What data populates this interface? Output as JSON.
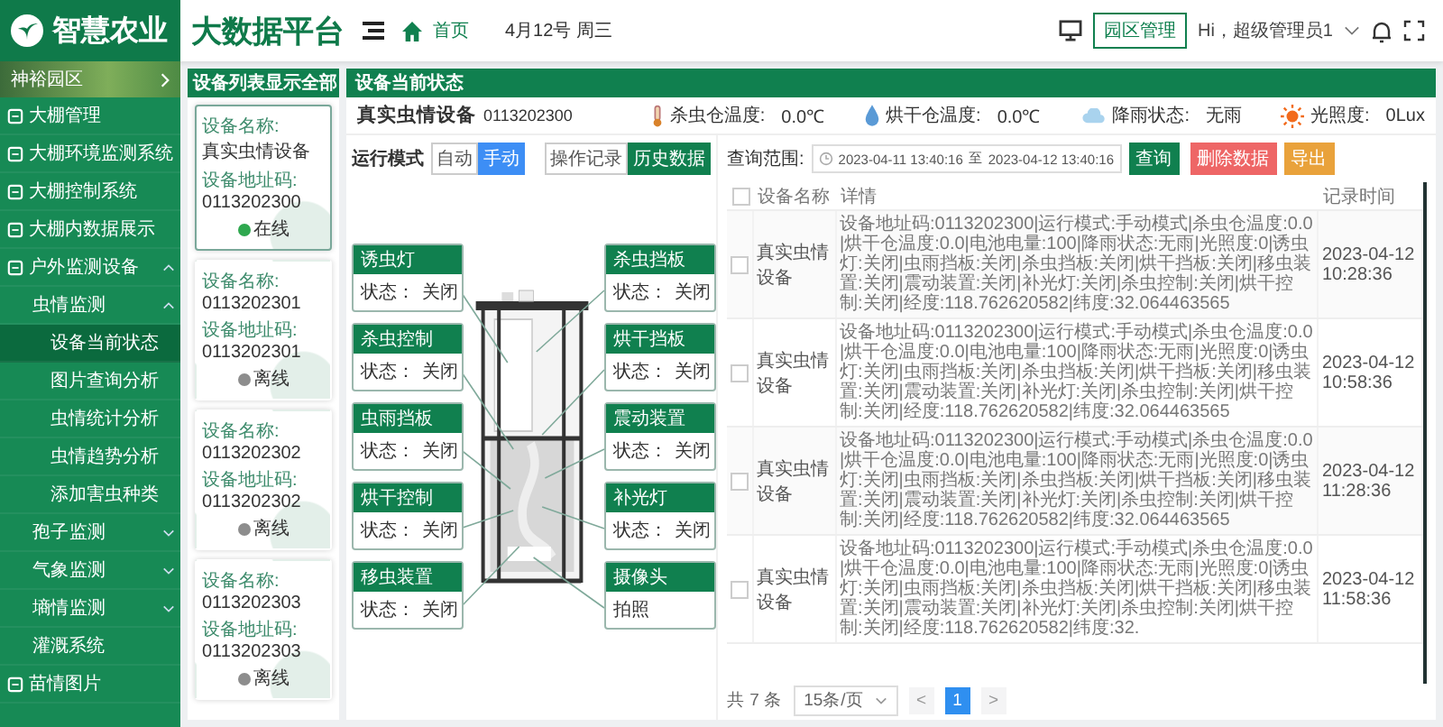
{
  "header": {
    "brand": "智慧农业",
    "title": "大数据平台",
    "breadcrumb": "首页",
    "date": "4月12号 周三",
    "park_button": "园区管理",
    "user": "Hi，超级管理员1"
  },
  "sidebar": {
    "park": "神裕园区",
    "items": [
      {
        "label": "大棚管理",
        "kind": "link",
        "selected": false
      },
      {
        "label": "大棚环境监测系统",
        "kind": "link",
        "selected": false
      },
      {
        "label": "大棚控制系统",
        "kind": "link",
        "selected": false
      },
      {
        "label": "大棚内数据展示",
        "kind": "link",
        "selected": false
      },
      {
        "label": "户外监测设备",
        "kind": "group",
        "expanded": true,
        "selected": false,
        "children": [
          {
            "label": "虫情监测",
            "kind": "group",
            "expanded": true,
            "selected": false,
            "children": [
              {
                "label": "设备当前状态",
                "kind": "link",
                "selected": true
              },
              {
                "label": "图片查询分析",
                "kind": "link",
                "selected": false
              },
              {
                "label": "虫情统计分析",
                "kind": "link",
                "selected": false
              },
              {
                "label": "虫情趋势分析",
                "kind": "link",
                "selected": false
              },
              {
                "label": "添加害虫种类",
                "kind": "link",
                "selected": false
              }
            ]
          },
          {
            "label": "孢子监测",
            "kind": "group",
            "expanded": false,
            "selected": false
          },
          {
            "label": "气象监测",
            "kind": "group",
            "expanded": false,
            "selected": false
          },
          {
            "label": "墒情监测",
            "kind": "group",
            "expanded": false,
            "selected": false
          },
          {
            "label": "灌溉系统",
            "kind": "link",
            "selected": false
          }
        ]
      },
      {
        "label": "苗情图片",
        "kind": "link",
        "selected": false
      }
    ]
  },
  "device_list": {
    "title": "设备列表",
    "show_all": "显示全部",
    "cards": [
      {
        "name_label": "设备名称:",
        "name": "真实虫情设备",
        "address_label": "设备地址码:",
        "address": "0113202300",
        "status": "在线",
        "online": true,
        "selected": true
      },
      {
        "name_label": "设备名称:",
        "name": "0113202301",
        "address_label": "设备地址码:",
        "address": "0113202301",
        "status": "离线",
        "online": false,
        "selected": false
      },
      {
        "name_label": "设备名称:",
        "name": "0113202302",
        "address_label": "设备地址码:",
        "address": "0113202302",
        "status": "离线",
        "online": false,
        "selected": false
      },
      {
        "name_label": "设备名称:",
        "name": "0113202303",
        "address_label": "设备地址码:",
        "address": "0113202303",
        "status": "离线",
        "online": false,
        "selected": false
      }
    ]
  },
  "panel": {
    "title": "设备当前状态",
    "device_name": "真实虫情设备",
    "device_code": "0113202300",
    "readings": [
      {
        "kind": "thermometer",
        "label": "杀虫仓温度:",
        "value": "0.0℃"
      },
      {
        "kind": "drop",
        "label": "烘干仓温度:",
        "value": "0.0℃"
      },
      {
        "kind": "cloud",
        "label": "降雨状态:",
        "value": "无雨"
      },
      {
        "kind": "sun",
        "label": "光照度:",
        "value": "0Lux"
      }
    ]
  },
  "mode": {
    "label": "运行模式",
    "options": [
      {
        "label": "自动",
        "selected": false
      },
      {
        "label": "手动",
        "selected": true
      }
    ]
  },
  "view_tabs": [
    {
      "label": "操作记录",
      "selected": false
    },
    {
      "label": "历史数据",
      "selected": true
    }
  ],
  "left_parts": [
    {
      "kind": "status",
      "title": "诱虫灯",
      "state_label": "状态：",
      "state": "关闭"
    },
    {
      "kind": "status",
      "title": "杀虫控制",
      "state_label": "状态：",
      "state": "关闭"
    },
    {
      "kind": "status",
      "title": "虫雨挡板",
      "state_label": "状态：",
      "state": "关闭"
    },
    {
      "kind": "status",
      "title": "烘干控制",
      "state_label": "状态：",
      "state": "关闭"
    },
    {
      "kind": "status",
      "title": "移虫装置",
      "state_label": "状态：",
      "state": "关闭"
    }
  ],
  "right_parts": [
    {
      "kind": "status",
      "title": "杀虫挡板",
      "state_label": "状态：",
      "state": "关闭"
    },
    {
      "kind": "status",
      "title": "烘干挡板",
      "state_label": "状态：",
      "state": "关闭"
    },
    {
      "kind": "status",
      "title": "震动装置",
      "state_label": "状态：",
      "state": "关闭"
    },
    {
      "kind": "status",
      "title": "补光灯",
      "state_label": "状态：",
      "state": "关闭"
    },
    {
      "kind": "action",
      "title": "摄像头",
      "action": "拍照"
    }
  ],
  "query": {
    "label": "查询范围:",
    "start": "2023-04-11 13:40:16",
    "separator": "至",
    "end": "2023-04-12 13:40:16",
    "buttons": [
      {
        "kind": "primary",
        "label": "查询"
      },
      {
        "kind": "danger",
        "label": "删除数据"
      },
      {
        "kind": "warning",
        "label": "导出"
      }
    ]
  },
  "table": {
    "all_checked": false,
    "columns": [
      "设备名称",
      "详情",
      "记录时间"
    ],
    "rows": [
      {
        "checked": false,
        "device": "真实虫情设备",
        "detail": "设备地址码:0113202300|运行模式:手动模式|杀虫仓温度:0.0|烘干仓温度:0.0|电池电量:100|降雨状态:无雨|光照度:0|诱虫灯:关闭|虫雨挡板:关闭|杀虫挡板:关闭|烘干挡板:关闭|移虫装置:关闭|震动装置:关闭|补光灯:关闭|杀虫控制:关闭|烘干控制:关闭|经度:118.762620582|纬度:32.064463565",
        "time": "2023-04-12 10:28:36"
      },
      {
        "checked": false,
        "device": "真实虫情设备",
        "detail": "设备地址码:0113202300|运行模式:手动模式|杀虫仓温度:0.0|烘干仓温度:0.0|电池电量:100|降雨状态:无雨|光照度:0|诱虫灯:关闭|虫雨挡板:关闭|杀虫挡板:关闭|烘干挡板:关闭|移虫装置:关闭|震动装置:关闭|补光灯:关闭|杀虫控制:关闭|烘干控制:关闭|经度:118.762620582|纬度:32.064463565",
        "time": "2023-04-12 10:58:36"
      },
      {
        "checked": false,
        "device": "真实虫情设备",
        "detail": "设备地址码:0113202300|运行模式:手动模式|杀虫仓温度:0.0|烘干仓温度:0.0|电池电量:100|降雨状态:无雨|光照度:0|诱虫灯:关闭|虫雨挡板:关闭|杀虫挡板:关闭|烘干挡板:关闭|移虫装置:关闭|震动装置:关闭|补光灯:关闭|杀虫控制:关闭|烘干控制:关闭|经度:118.762620582|纬度:32.064463565",
        "time": "2023-04-12 11:28:36"
      },
      {
        "checked": false,
        "device": "真实虫情设备",
        "detail": "设备地址码:0113202300|运行模式:手动模式|杀虫仓温度:0.0|烘干仓温度:0.0|电池电量:100|降雨状态:无雨|光照度:0|诱虫灯:关闭|虫雨挡板:关闭|杀虫挡板:关闭|烘干挡板:关闭|移虫装置:关闭|震动装置:关闭|补光灯:关闭|杀虫控制:关闭|烘干控制:关闭|经度:118.762620582|纬度:32.",
        "time": "2023-04-12 11:58:36"
      }
    ]
  },
  "pagination": {
    "total": "共 7 条",
    "page_size": "15条/页",
    "prev": "<",
    "next": ">",
    "pages": [
      {
        "label": "1",
        "selected": true
      }
    ]
  }
}
